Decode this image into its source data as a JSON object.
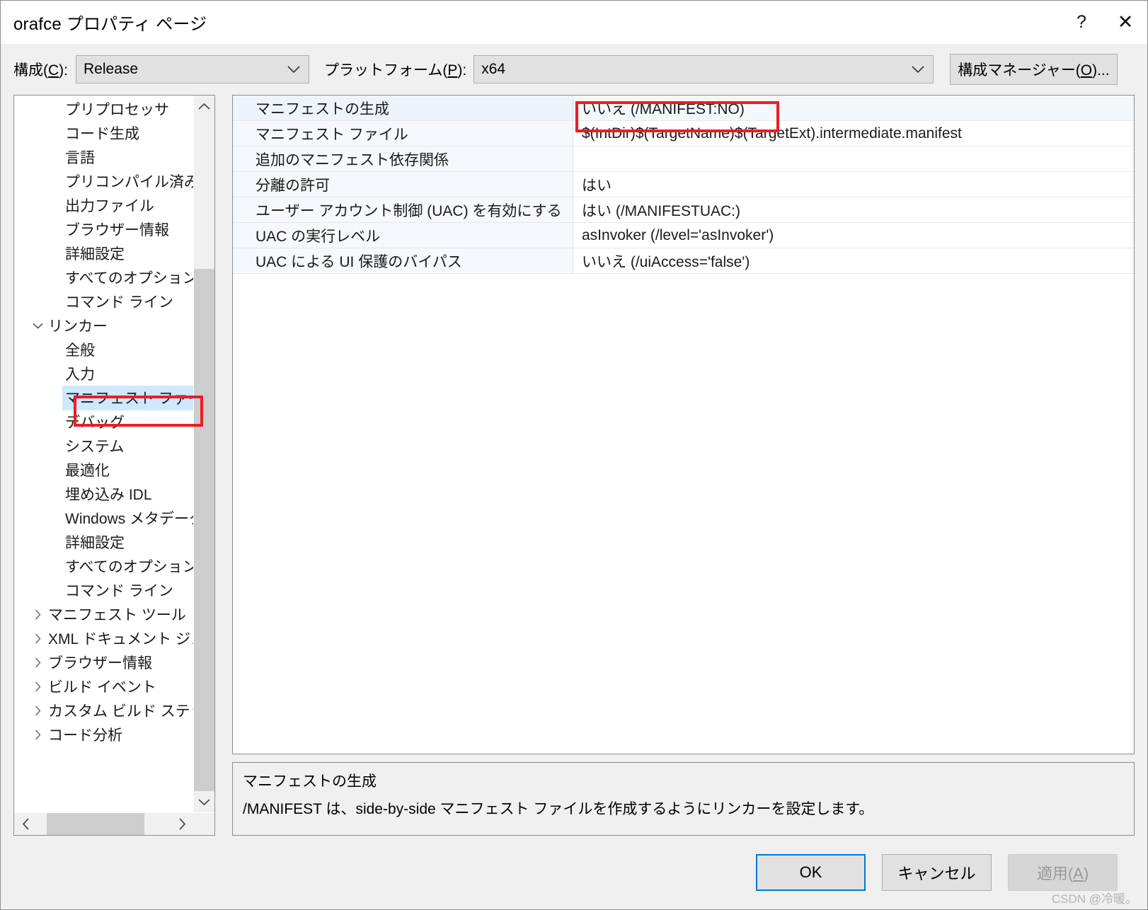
{
  "window": {
    "title": "orafce プロパティ ページ",
    "help_icon": "?",
    "close_icon": "✕"
  },
  "configbar": {
    "configuration_label": "構成(C):",
    "configuration_value": "Release",
    "platform_label": "プラットフォーム(P):",
    "platform_value": "x64",
    "config_manager_button": "構成マネージャー(O)...",
    "chevron_icon": "⌄"
  },
  "tree": {
    "items": [
      {
        "label": "プリプロセッサ",
        "level": 1,
        "twisty": "",
        "selected": false
      },
      {
        "label": "コード生成",
        "level": 1,
        "twisty": "",
        "selected": false
      },
      {
        "label": "言語",
        "level": 1,
        "twisty": "",
        "selected": false
      },
      {
        "label": "プリコンパイル済み",
        "level": 1,
        "twisty": "",
        "selected": false
      },
      {
        "label": "出力ファイル",
        "level": 1,
        "twisty": "",
        "selected": false
      },
      {
        "label": "ブラウザー情報",
        "level": 1,
        "twisty": "",
        "selected": false
      },
      {
        "label": "詳細設定",
        "level": 1,
        "twisty": "",
        "selected": false
      },
      {
        "label": "すべてのオプション",
        "level": 1,
        "twisty": "",
        "selected": false
      },
      {
        "label": "コマンド ライン",
        "level": 1,
        "twisty": "",
        "selected": false
      },
      {
        "label": "リンカー",
        "level": 0,
        "twisty": "⌄",
        "selected": false
      },
      {
        "label": "全般",
        "level": 1,
        "twisty": "",
        "selected": false
      },
      {
        "label": "入力",
        "level": 1,
        "twisty": "",
        "selected": false
      },
      {
        "label": "マニフェスト ファイル",
        "level": 1,
        "twisty": "",
        "selected": true
      },
      {
        "label": "デバッグ",
        "level": 1,
        "twisty": "",
        "selected": false
      },
      {
        "label": "システム",
        "level": 1,
        "twisty": "",
        "selected": false
      },
      {
        "label": "最適化",
        "level": 1,
        "twisty": "",
        "selected": false
      },
      {
        "label": "埋め込み IDL",
        "level": 1,
        "twisty": "",
        "selected": false
      },
      {
        "label": "Windows メタデータ",
        "level": 1,
        "twisty": "",
        "selected": false
      },
      {
        "label": "詳細設定",
        "level": 1,
        "twisty": "",
        "selected": false
      },
      {
        "label": "すべてのオプション",
        "level": 1,
        "twisty": "",
        "selected": false
      },
      {
        "label": "コマンド ライン",
        "level": 1,
        "twisty": "",
        "selected": false
      },
      {
        "label": "マニフェスト ツール",
        "level": 0,
        "twisty": "›",
        "selected": false
      },
      {
        "label": "XML ドキュメント ジェ",
        "level": 0,
        "twisty": "›",
        "selected": false
      },
      {
        "label": "ブラウザー情報",
        "level": 0,
        "twisty": "›",
        "selected": false
      },
      {
        "label": "ビルド イベント",
        "level": 0,
        "twisty": "›",
        "selected": false
      },
      {
        "label": "カスタム ビルド ステッ",
        "level": 0,
        "twisty": "›",
        "selected": false
      },
      {
        "label": "コード分析",
        "level": 0,
        "twisty": "›",
        "selected": false
      }
    ],
    "scroll_up_icon": "⌃",
    "scroll_down_icon": "⌄",
    "scroll_left_icon": "‹",
    "scroll_right_icon": "›"
  },
  "grid": {
    "rows": [
      {
        "name": "マニフェストの生成",
        "value": "いいえ (/MANIFEST:NO)",
        "selected": true
      },
      {
        "name": "マニフェスト ファイル",
        "value": "$(IntDir)$(TargetName)$(TargetExt).intermediate.manifest",
        "selected": false
      },
      {
        "name": "追加のマニフェスト依存関係",
        "value": "",
        "selected": false
      },
      {
        "name": "分離の許可",
        "value": "はい",
        "selected": false
      },
      {
        "name": "ユーザー アカウント制御 (UAC) を有効にする",
        "value": "はい (/MANIFESTUAC:)",
        "selected": false
      },
      {
        "name": "UAC の実行レベル",
        "value": "asInvoker (/level='asInvoker')",
        "selected": false
      },
      {
        "name": "UAC による UI 保護のバイパス",
        "value": "いいえ (/uiAccess='false')",
        "selected": false
      }
    ]
  },
  "description": {
    "title": "マニフェストの生成",
    "text": "/MANIFEST は、side-by-side マニフェスト ファイルを作成するようにリンカーを設定します。"
  },
  "footer": {
    "ok_label": "OK",
    "cancel_label": "キャンセル",
    "apply_label": "適用(A)",
    "watermark": "CSDN @冷暖。"
  },
  "colors": {
    "accent": "#0078d7",
    "annotation": "#ee1c25",
    "selection": "#cde8ff",
    "dialog_bg": "#f0f0f0"
  }
}
